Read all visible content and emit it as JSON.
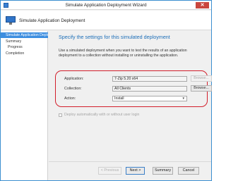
{
  "window": {
    "title": "Simulate Application Deployment Wizard",
    "close_glyph": "✕",
    "accent_color": "#3d8ee0"
  },
  "header": {
    "title": "Simulate Application Deployment",
    "icon": "computer-icon"
  },
  "sidebar": {
    "items": [
      {
        "label": "Simulate Application Deployment",
        "active": true
      },
      {
        "label": "Summary",
        "active": false
      },
      {
        "label": "Progress",
        "active": false
      },
      {
        "label": "Completion",
        "active": false
      }
    ]
  },
  "main": {
    "heading": "Specify the settings for this simulated deployment",
    "description": "Use a simulated deployment when you want to test the results of an application deployment to a collection without installing or uninstalling the application.",
    "fields": {
      "application": {
        "label": "Application:",
        "value": "7-Zip 5.20 x64",
        "browse_label": "Browse...",
        "browse_enabled": false
      },
      "collection": {
        "label": "Collection:",
        "value": "All Clients",
        "browse_label": "Browse...",
        "browse_enabled": true
      },
      "action": {
        "label": "Action:",
        "value": "Install"
      }
    },
    "checkbox_label": "Deploy automatically with or without user login",
    "checkbox_checked": false,
    "highlight_color": "#d21e2b"
  },
  "buttons": {
    "previous": "< Previous",
    "next": "Next >",
    "summary": "Summary",
    "cancel": "Cancel"
  }
}
